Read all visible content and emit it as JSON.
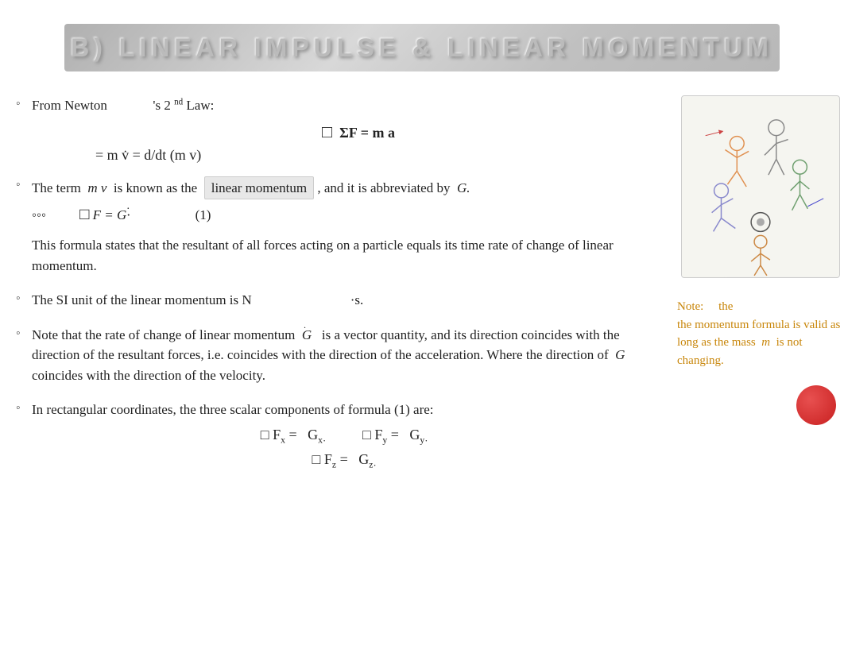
{
  "header": {
    "title": "b) LINEAR IMPULSE & LINEAR MOMENTUM"
  },
  "sections": [
    {
      "id": "newton-law",
      "bullet": "◦",
      "intro": "From Newton",
      "intro2": "'s 2",
      "superscript": "nd",
      "intro3": " Law:",
      "formula1": "ΣF  =  m a",
      "formula2": "= m v̇ = d/dt (m v)"
    },
    {
      "id": "linear-momentum",
      "bullet": "◦",
      "text1": "The term",
      "math1": "m v",
      "text2": "is known as the",
      "highlighted": "linear momentum",
      "text3": ", and it is abbreviated by",
      "math2": "G.",
      "formula": "ΣF = G·",
      "label": "(1)"
    },
    {
      "id": "formula-statement",
      "bullet": "",
      "text": "This formula states that the resultant of all forces acting on a particle equals its time rate of change of linear momentum."
    },
    {
      "id": "si-unit",
      "bullet": "◦",
      "text": "The SI unit of the linear momentum is N",
      "suffix": "·s."
    },
    {
      "id": "rate-change",
      "bullet": "◦",
      "text1": "Note that the rate of change of linear momentum",
      "math1": "Ġ",
      "text2": "is a vector quantity, and its direction coincides with the direction of the resultant forces, i.e. coincides with the direction of the acceleration. Where the direction of",
      "math2": "G",
      "text3": "coincides with the direction of the velocity."
    },
    {
      "id": "rectangular-coords",
      "bullet": "◦",
      "text": "In rectangular coordinates, the three scalar components of formula (1) are:",
      "formula_x": "ΣFx = Ġx",
      "formula_y": "ΣFy = Ġy",
      "formula_z": "ΣFz = Ġz"
    }
  ],
  "note": {
    "prefix": "Note:",
    "text": "the momentum formula is valid as long as the mass",
    "math": "m",
    "suffix": "is not changing."
  },
  "dots_label": "◦◦◦",
  "image_alt": "Sports figures diagram",
  "red_circle_label": ""
}
